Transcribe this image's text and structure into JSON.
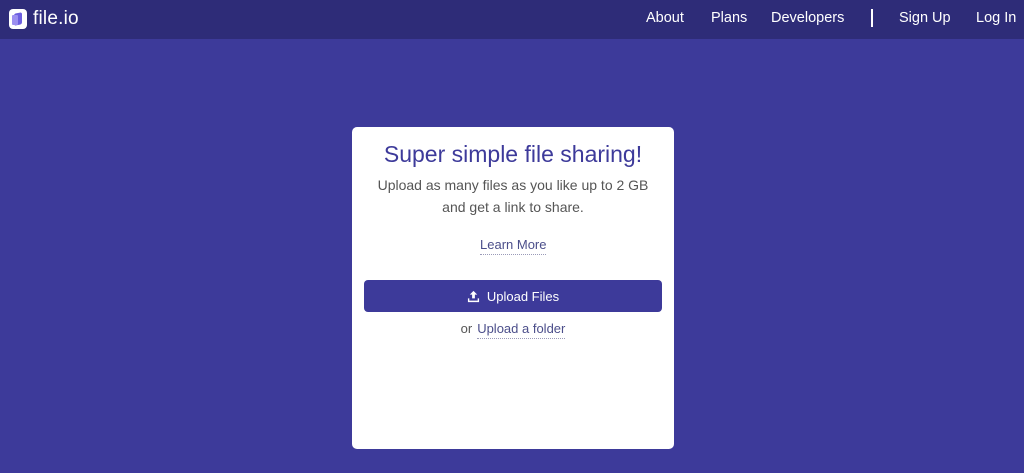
{
  "brand": {
    "name": "file.io",
    "logo_icon": "fileio-logo-icon"
  },
  "nav": {
    "about": "About",
    "plans": "Plans",
    "developers": "Developers",
    "sign_up": "Sign Up",
    "log_in": "Log In"
  },
  "card": {
    "headline": "Super simple file sharing!",
    "subline_1": "Upload as many files as you like up to 2 GB",
    "subline_2": "and get a link to share.",
    "learn_more": "Learn More",
    "upload_button": "Upload Files",
    "upload_icon": "upload-icon",
    "or_text": "or",
    "upload_folder": "Upload a folder"
  },
  "colors": {
    "background": "#3d3a9a",
    "topbar": "#2e2c78",
    "accent": "#3d3a9a",
    "card": "#ffffff"
  }
}
